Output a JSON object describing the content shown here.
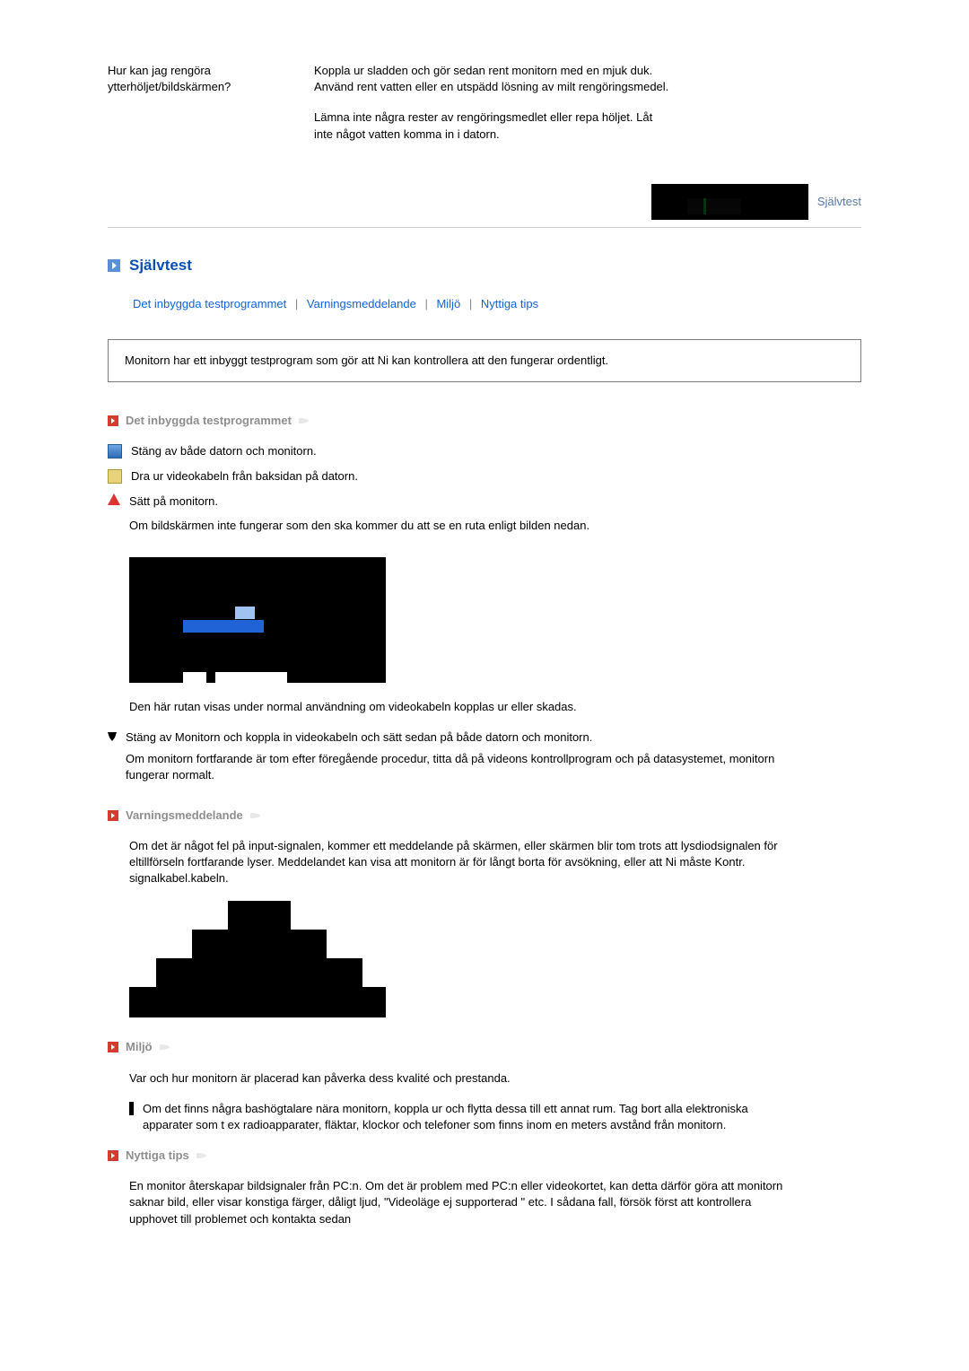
{
  "qa": {
    "question": "Hur kan jag rengöra ytterhöljet/bildskärmen?",
    "answer_p1": "Koppla ur sladden och gör sedan rent monitorn med en mjuk duk. Använd rent vatten eller en utspädd lösning av milt rengöringsmedel.",
    "answer_p2": "Lämna inte några rester av rengöringsmedlet eller repa höljet. Låt inte något vatten komma in i datorn."
  },
  "heading_bar_label": "Självtest",
  "section_title": "Självtest",
  "nav": {
    "a1": "Det inbyggda testprogrammet",
    "a2": "Varningsmeddelande",
    "a3": "Miljö",
    "a4": "Nyttiga tips",
    "sep": "|"
  },
  "info_box": "Monitorn har ett inbyggt testprogram som gör att Ni kan kontrollera att den fungerar ordentligt.",
  "sub1_title": "Det inbyggda testprogrammet",
  "steps": {
    "s1": "Stäng av både datorn och monitorn.",
    "s2": "Dra ur videokabeln från baksidan på datorn.",
    "s3": "Sätt på monitorn.",
    "s3_body": "Om bildskärmen inte fungerar som den ska kommer du att se en ruta enligt bilden nedan.",
    "after_img": "Den här rutan visas under normal användning om videokabeln kopplas ur eller skadas.",
    "s4": "Stäng av Monitorn och koppla in videokabeln och sätt sedan på både datorn och monitorn.",
    "s4_body": "Om monitorn fortfarande är tom efter föregående procedur, titta då på videons kontrollprogram och på datasystemet, monitorn fungerar normalt."
  },
  "sub2_title": "Varningsmeddelande",
  "sub2_body": "Om det är något fel på input-signalen, kommer ett meddelande på skärmen, eller skärmen blir tom trots att lysdiodsignalen för eltillförseln fortfarande lyser. Meddelandet kan visa att monitorn är för långt borta för avsökning, eller att Ni måste Kontr. signalkabel.kabeln.",
  "sub3_title": "Miljö",
  "sub3_p1": "Var och hur monitorn är placerad kan påverka dess kvalité och prestanda.",
  "sub3_p2": "Om det finns några bashögtalare nära monitorn, koppla ur och flytta dessa till ett annat rum. Tag bort alla elektroniska apparater som t ex radioapparater, fläktar, klockor och telefoner som finns inom en meters avstånd från monitorn.",
  "sub4_title": "Nyttiga tips",
  "sub4_body": "En monitor återskapar bildsignaler från PC:n. Om det är problem med PC:n eller videokortet, kan detta därför göra att monitorn saknar bild, eller visar konstiga färger, dåligt ljud, \"Videoläge ej supporterad \" etc. I sådana fall, försök först att kontrollera upphovet till problemet och kontakta sedan"
}
